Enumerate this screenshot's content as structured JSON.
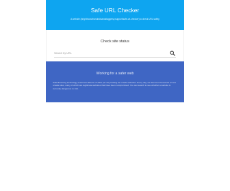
{
  "header": {
    "title": "Safe URL Checker",
    "subtitle": "A website (brighthousehandrailsandstaggersy.support/safe-url-checker) to check URL safety"
  },
  "checker": {
    "title": "Check site status",
    "search_placeholder": "Search by URL",
    "search_icon": "search-icon"
  },
  "info": {
    "heading": "Working for a safer web",
    "text": "Safe Browsing technology examines billions of URLs per day looking for unsafe websites. Every day, we discover thousands of new unsafe sites, many of which are legitimate websites that have been compromised. You can search to see whether a website is currently dangerous to visit."
  },
  "colors": {
    "header_background": "#0ea5f0",
    "info_background": "#3f66c4",
    "text_dark": "#333333"
  }
}
